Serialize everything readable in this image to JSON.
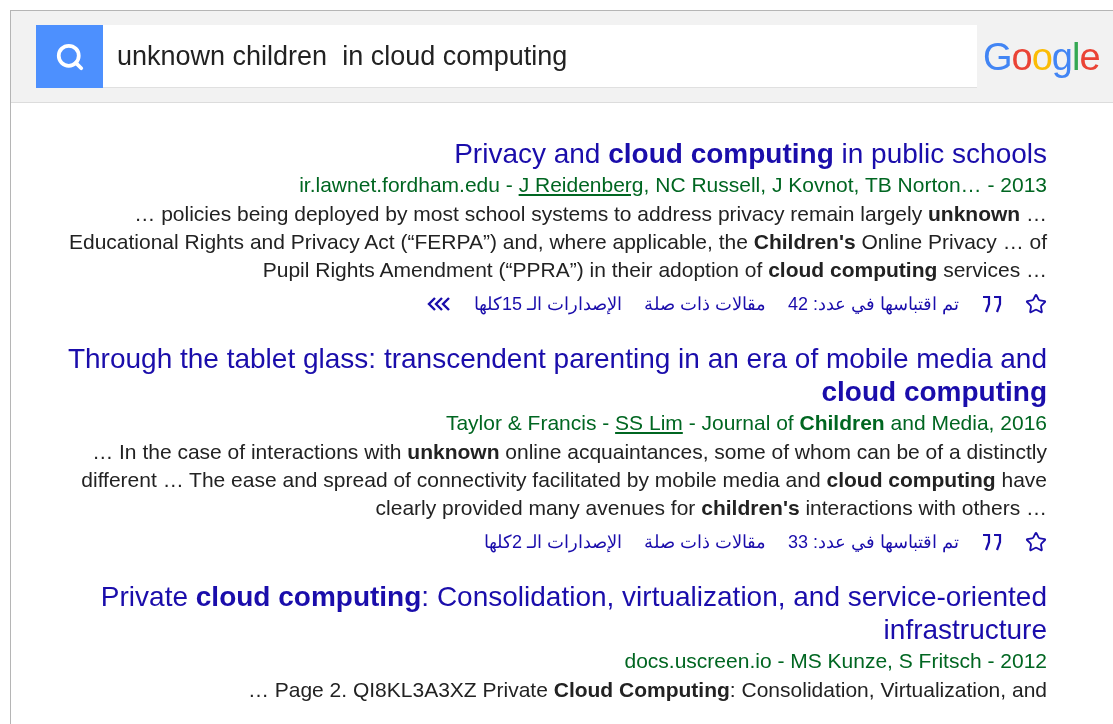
{
  "search": {
    "value": "unknown children  in cloud computing"
  },
  "logo": {
    "letters": [
      {
        "text": "G",
        "color": "#4285f4"
      },
      {
        "text": "o",
        "color": "#ea4335"
      },
      {
        "text": "o",
        "color": "#fbbc05"
      },
      {
        "text": "g",
        "color": "#4285f4"
      },
      {
        "text": "l",
        "color": "#34a853"
      },
      {
        "text": "e",
        "color": "#ea4335"
      }
    ]
  },
  "results": [
    {
      "title": "Privacy and **cloud computing** in public schools",
      "meta": [
        {
          "text": "ir.lawnet.fordham.edu - ",
          "link": false
        },
        {
          "text": "J Reidenberg",
          "link": true
        },
        {
          "text": ", NC Russell, J Kovnot, TB Norton… - 2013",
          "link": false
        }
      ],
      "snippet": "… policies being deployed by most school systems to address privacy remain largely **unknown** … Educational Rights and Privacy Act (“FERPA”) and, where applicable, the **Children's** Online Privacy … of Pupil Rights Amendment (“PPRA”) in their adoption of **cloud computing** services …",
      "actions": {
        "cited": "تم اقتباسها في عدد: 42",
        "related": "مقالات ذات صلة",
        "versions": "الإصدارات الـ 15كلها",
        "more": true
      }
    },
    {
      "title": "Through the tablet glass: transcendent parenting in an era of mobile media and **cloud computing**",
      "meta": [
        {
          "text": "Taylor & Francis - ",
          "link": false
        },
        {
          "text": "SS Lim",
          "link": true
        },
        {
          "text": " - Journal of **Children** and Media, 2016",
          "link": false
        }
      ],
      "snippet": "… In the case of interactions with **unknown** online acquaintances, some of whom can be of a distinctly different … The ease and spread of connectivity facilitated by mobile media and **cloud computing** have clearly provided many avenues for **children's** interactions with others …",
      "actions": {
        "cited": "تم اقتباسها في عدد: 33",
        "related": "مقالات ذات صلة",
        "versions": "الإصدارات الـ 2كلها",
        "more": false
      }
    },
    {
      "title": "Private **cloud computing**: Consolidation, virtualization, and service-oriented infrastructure",
      "meta": [
        {
          "text": "docs.uscreen.io - MS Kunze, S Fritsch - 2012",
          "link": false
        }
      ],
      "snippet": "… Page 2. QI8KL3A3XZ Private **Cloud Computing**: Consolidation, Virtualization, and"
    }
  ]
}
